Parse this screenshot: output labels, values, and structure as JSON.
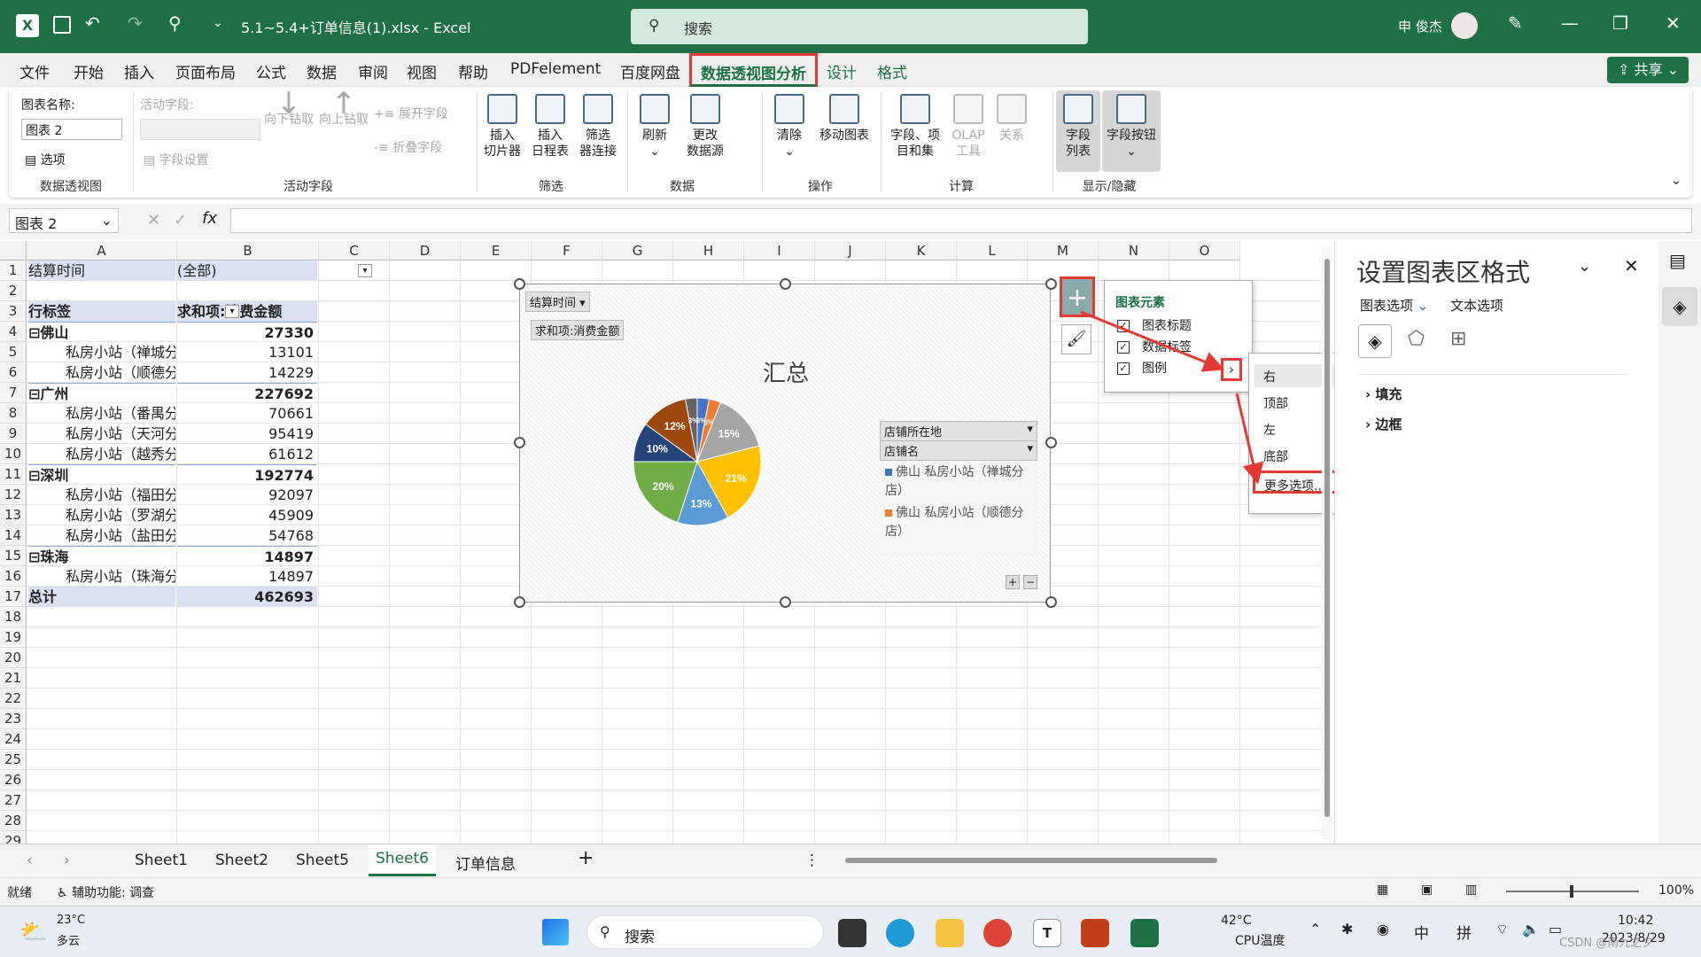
{
  "titlebar": {
    "filename": "5.1~5.4+订单信息(1).xlsx  -  Excel",
    "search_placeholder": "搜索",
    "user": "申 俊杰"
  },
  "menu": [
    "文件",
    "开始",
    "插入",
    "页面布局",
    "公式",
    "数据",
    "审阅",
    "视图",
    "帮助",
    "PDFelement",
    "百度网盘",
    "数据透视图分析",
    "设计",
    "格式"
  ],
  "share_label": "共享",
  "ribbon": {
    "chart_name_label": "图表名称:",
    "chart_name_value": "图表 2",
    "options_label": "选项",
    "group1": "数据透视图",
    "active_field_label": "活动字段:",
    "field_settings": "字段设置",
    "drill_down": "向下钻取",
    "drill_up": "向上钻取",
    "expand_field": "展开字段",
    "collapse_field": "折叠字段",
    "group2": "活动字段",
    "insert_slicer": "插入\n切片器",
    "insert_timeline": "插入\n日程表",
    "filter_conn": "筛选\n器连接",
    "group3": "筛选",
    "refresh": "刷新",
    "change_source": "更改\n数据源",
    "group4": "数据",
    "clear": "清除",
    "move_chart": "移动图表",
    "group5": "操作",
    "fields_items": "字段、项\n目和集",
    "olap": "OLAP\n工具",
    "relations": "关系",
    "group6": "计算",
    "field_list": "字段\n列表",
    "field_buttons": "字段按钮",
    "group7": "显示/隐藏"
  },
  "formula": {
    "name_box": "图表 2",
    "fx": "fx"
  },
  "columns": [
    "A",
    "B",
    "C",
    "D",
    "E",
    "F",
    "G",
    "H",
    "I",
    "J",
    "K",
    "L",
    "M",
    "N",
    "O"
  ],
  "rows": [
    "1",
    "2",
    "3",
    "4",
    "5",
    "6",
    "7",
    "8",
    "9",
    "10",
    "11",
    "12",
    "13",
    "14",
    "15",
    "16",
    "17",
    "18",
    "19",
    "20",
    "21",
    "22",
    "23",
    "24",
    "25",
    "26",
    "27",
    "28",
    "29"
  ],
  "pivot": [
    {
      "a": "结算时间",
      "b": "(全部)",
      "style": "filter"
    },
    {
      "a": "",
      "b": "",
      "style": "blank"
    },
    {
      "a": "行标签",
      "b": "求和项:消费金额",
      "style": "header"
    },
    {
      "a": "⊟佛山",
      "b": "27330",
      "style": "group"
    },
    {
      "a": "私房小站（禅城分店）",
      "b": "13101",
      "style": "item"
    },
    {
      "a": "私房小站（顺德分店）",
      "b": "14229",
      "style": "item"
    },
    {
      "a": "⊟广州",
      "b": "227692",
      "style": "group"
    },
    {
      "a": "私房小站（番禺分店）",
      "b": "70661",
      "style": "item"
    },
    {
      "a": "私房小站（天河分店）",
      "b": "95419",
      "style": "item"
    },
    {
      "a": "私房小站（越秀分店）",
      "b": "61612",
      "style": "item"
    },
    {
      "a": "⊟深圳",
      "b": "192774",
      "style": "group"
    },
    {
      "a": "私房小站（福田分店）",
      "b": "92097",
      "style": "item"
    },
    {
      "a": "私房小站（罗湖分店）",
      "b": "45909",
      "style": "item"
    },
    {
      "a": "私房小站（盐田分店）",
      "b": "54768",
      "style": "item"
    },
    {
      "a": "⊟珠海",
      "b": "14897",
      "style": "group"
    },
    {
      "a": "私房小站（珠海分店）",
      "b": "14897",
      "style": "item"
    },
    {
      "a": "总计",
      "b": "462693",
      "style": "total"
    }
  ],
  "chart": {
    "filter_btn": "结算时间",
    "value_btn": "求和项:消费金额",
    "title": "汇总",
    "legend_btn1": "店铺所在地",
    "legend_btn2": "店铺名",
    "legend_items": [
      {
        "label": "佛山 私房小站（禅城分店）",
        "color": "#4472c4"
      },
      {
        "label": "佛山 私房小站（顺德分店）",
        "color": "#ed7d31"
      }
    ],
    "slices": [
      {
        "label": "3%",
        "value": 3,
        "color": "#4472c4"
      },
      {
        "label": "3%",
        "value": 3,
        "color": "#ed7d31"
      },
      {
        "label": "15%",
        "value": 15,
        "color": "#a5a5a5"
      },
      {
        "label": "21%",
        "value": 21,
        "color": "#ffc000"
      },
      {
        "label": "13%",
        "value": 13,
        "color": "#5b9bd5"
      },
      {
        "label": "20%",
        "value": 20,
        "color": "#70ad47"
      },
      {
        "label": "10%",
        "value": 10,
        "color": "#264478"
      },
      {
        "label": "12%",
        "value": 12,
        "color": "#9e480e"
      },
      {
        "label": "3%",
        "value": 3,
        "color": "#636363"
      }
    ]
  },
  "chart_data": {
    "type": "pie",
    "title": "汇总",
    "categories": [
      "佛山 私房小站（禅城分店）",
      "佛山 私房小站（顺德分店）",
      "广州 私房小站（番禺分店）",
      "广州 私房小站（天河分店）",
      "广州 私房小站（越秀分店）",
      "深圳 私房小站（福田分店）",
      "深圳 私房小站（罗湖分店）",
      "深圳 私房小站（盐田分店）",
      "珠海 私房小站（珠海分店）"
    ],
    "values": [
      13101,
      14229,
      70661,
      95419,
      61612,
      92097,
      45909,
      54768,
      14897
    ],
    "data_labels": [
      "3%",
      "3%",
      "15%",
      "21%",
      "13%",
      "20%",
      "10%",
      "12%",
      "3%"
    ]
  },
  "elements_popup": {
    "title": "图表元素",
    "items": [
      {
        "label": "图表标题",
        "checked": true
      },
      {
        "label": "数据标签",
        "checked": true
      },
      {
        "label": "图例",
        "checked": true
      }
    ]
  },
  "legend_submenu": [
    "右",
    "顶部",
    "左",
    "底部",
    "更多选项..."
  ],
  "format_panel": {
    "title": "设置图表区格式",
    "tab1": "图表选项",
    "tab2": "文本选项",
    "fill": "填充",
    "border": "边框"
  },
  "sheets": [
    "Sheet1",
    "Sheet2",
    "Sheet5",
    "Sheet6",
    "订单信息"
  ],
  "active_sheet": "Sheet6",
  "status": {
    "ready": "就绪",
    "accessibility": "辅助功能: 调查",
    "zoom": "100%"
  },
  "taskbar": {
    "temp": "23°C",
    "weather": "多云",
    "search": "搜索",
    "cpu_temp": "42°C",
    "cpu_label": "CPU温度",
    "ime1": "中",
    "ime2": "拼",
    "time": "10:42",
    "date": "2023/8/29",
    "watermark": "CSDN @南九之夕"
  }
}
